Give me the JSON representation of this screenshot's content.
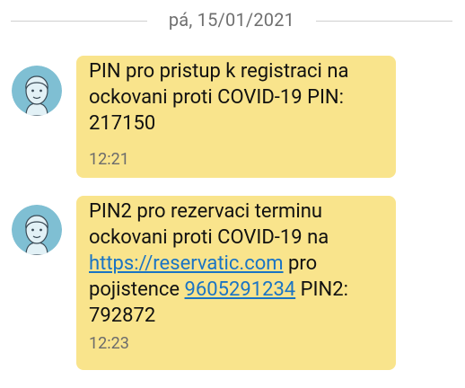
{
  "conversation": {
    "date_divider": "pá, 15/01/2021",
    "messages": [
      {
        "line1": "PIN pro pristup k registraci na",
        "line2": "ockovani proti COVID-19 PIN:",
        "line3": "217150",
        "time": "12:21"
      },
      {
        "line1": "PIN2 pro rezervaci terminu",
        "line2": "ockovani proti COVID-19 na",
        "link": "https://reservatic.com",
        "after_link": " pro",
        "prefix_phone": "pojistence ",
        "phone": "9605291234",
        "after_phone": " PIN2:",
        "line5": "792872",
        "time": "12:23"
      }
    ]
  },
  "colors": {
    "bubble": "#f9e48c",
    "avatar_bg": "#7fbfd3",
    "avatar_face": "#e2f1f6",
    "link": "#1a74c4"
  },
  "icons": {
    "avatar": "default-contact-avatar-icon"
  }
}
